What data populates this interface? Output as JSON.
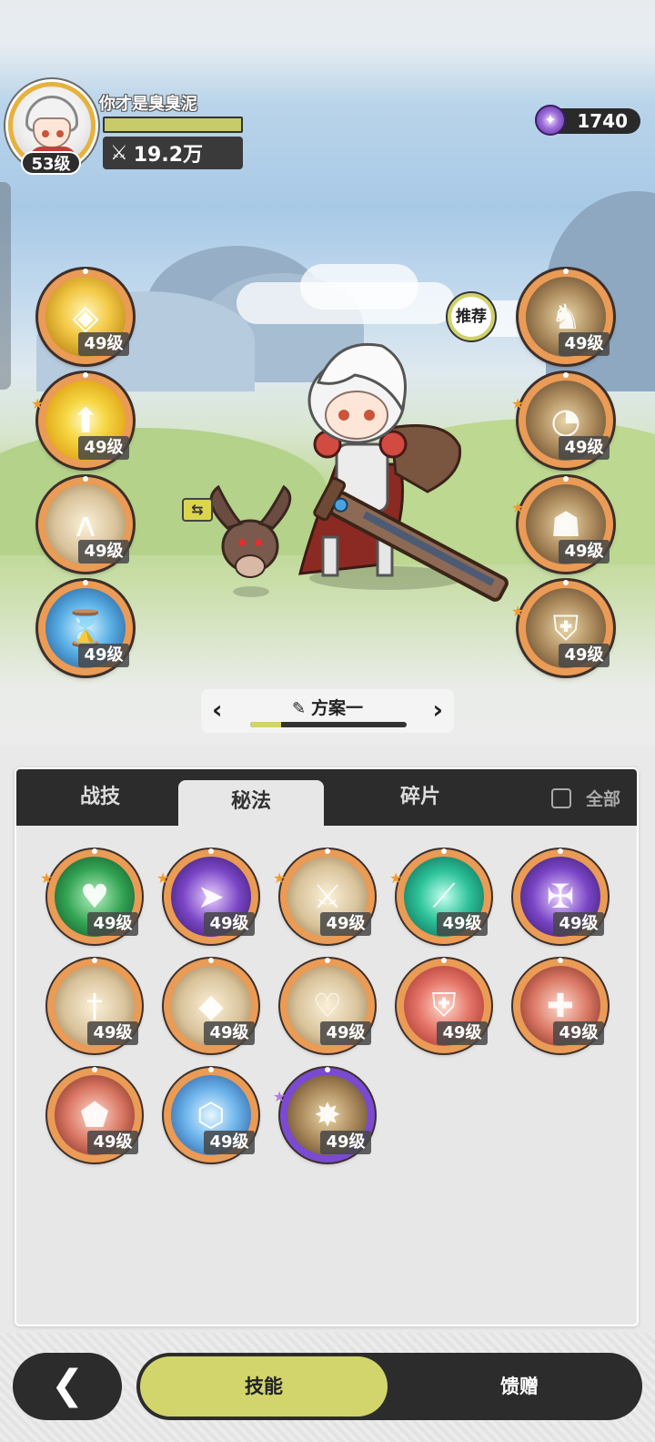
{
  "player": {
    "name": "你才是臭臭泥",
    "level_label": "53级",
    "exp_fraction": 1.0,
    "power_icon": "crossed-swords-icon",
    "power_value": "19.2万"
  },
  "currency": {
    "icon": "purple-gem-icon",
    "amount": "1740"
  },
  "recommend_label": "推荐",
  "left_skills": [
    {
      "level": "49级",
      "icon": "golden-rune-icon",
      "star": false
    },
    {
      "level": "49级",
      "icon": "golden-arrows-icon",
      "star": true
    },
    {
      "level": "49级",
      "icon": "beige-wings-icon",
      "star": false
    },
    {
      "level": "49级",
      "icon": "blue-hourglass-icon",
      "star": false
    }
  ],
  "right_skills": [
    {
      "level": "49级",
      "icon": "bronze-beast-icon",
      "star": false
    },
    {
      "level": "49级",
      "icon": "bronze-spiral-icon",
      "star": true
    },
    {
      "level": "49级",
      "icon": "bronze-golem-icon",
      "star": true
    },
    {
      "level": "49级",
      "icon": "bronze-armor-icon",
      "star": true
    }
  ],
  "plan": {
    "title": "方案一",
    "progress_fraction": 0.2
  },
  "tabs": [
    "战技",
    "秘法",
    "碎片"
  ],
  "active_tab": "秘法",
  "all_toggle_label": "全部",
  "grid_skills": [
    {
      "level": "49级",
      "icon": "green-heart-icon",
      "star": true,
      "epic": false
    },
    {
      "level": "49级",
      "icon": "purple-panther-icon",
      "star": true,
      "epic": false
    },
    {
      "level": "49级",
      "icon": "sword-arrows-icon",
      "star": true,
      "epic": false
    },
    {
      "level": "49级",
      "icon": "teal-blade-icon",
      "star": true,
      "epic": false
    },
    {
      "level": "49级",
      "icon": "purple-sword-icon",
      "star": false,
      "epic": false
    },
    {
      "level": "49级",
      "icon": "sword-up-icon",
      "star": false,
      "epic": false
    },
    {
      "level": "49级",
      "icon": "dark-blade-icon",
      "star": false,
      "epic": false
    },
    {
      "level": "49级",
      "icon": "shield-heart-icon",
      "star": false,
      "epic": false
    },
    {
      "level": "49级",
      "icon": "red-shield-icon",
      "star": false,
      "epic": false
    },
    {
      "level": "49级",
      "icon": "red-sword-icon",
      "star": false,
      "epic": false
    },
    {
      "level": "49级",
      "icon": "red-gem-icon",
      "star": false,
      "epic": false
    },
    {
      "level": "49级",
      "icon": "blue-shield-icon",
      "star": false,
      "epic": false
    },
    {
      "level": "49级",
      "icon": "golden-spikes-icon",
      "star": true,
      "epic": true
    }
  ],
  "bottom_nav": {
    "back_icon": "back-arrow-icon",
    "skill_label": "技能",
    "gift_label": "馈赠"
  }
}
